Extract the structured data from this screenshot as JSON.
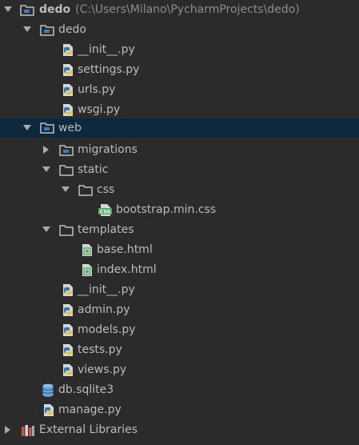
{
  "tree": {
    "root": {
      "name": "dedo",
      "path": "(C:\\Users\\Milano\\PycharmProjects\\dedo)"
    },
    "dedo_pkg": {
      "name": "dedo",
      "files": [
        "__init__.py",
        "settings.py",
        "urls.py",
        "wsgi.py"
      ]
    },
    "web": {
      "name": "web",
      "migrations": "migrations",
      "static": "static",
      "css": "css",
      "css_file": "bootstrap.min.css",
      "templates": "templates",
      "html_files": [
        "base.html",
        "index.html"
      ],
      "files": [
        "__init__.py",
        "admin.py",
        "models.py",
        "tests.py",
        "views.py"
      ]
    },
    "db_file": "db.sqlite3",
    "manage_file": "manage.py",
    "external_libraries": "External Libraries"
  },
  "colors": {
    "background": "#2b2b2b",
    "selection": "#0d293e",
    "text": "#bbbbbb",
    "path_text": "#8c8c8c",
    "folder": "#c0c0c0",
    "module_badge": "#3d7dbd",
    "python_blue": "#3d75ab",
    "python_yellow": "#e7c52d",
    "css_green": "#59a869",
    "html_green": "#59a869",
    "db_blue": "#6ba6d9"
  },
  "icons": {
    "module_folder": "module-folder-icon",
    "folder": "folder-icon",
    "python": "python-file-icon",
    "css": "css-file-icon",
    "html": "html-file-icon",
    "database": "database-file-icon",
    "libraries": "libraries-icon"
  }
}
